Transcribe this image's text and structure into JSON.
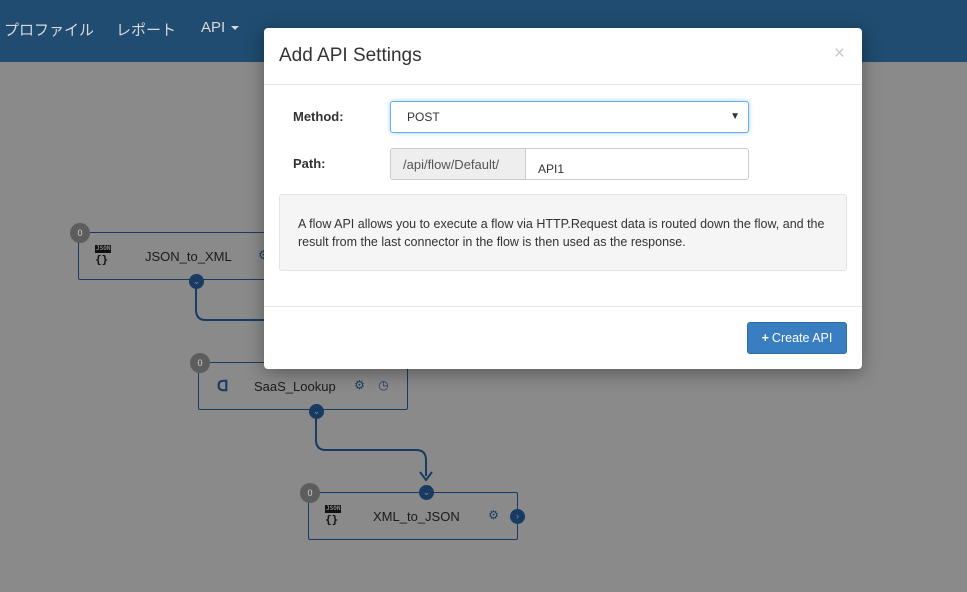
{
  "nav": {
    "items": [
      {
        "label": "プロファイル"
      },
      {
        "label": "レポート"
      },
      {
        "label": "API"
      }
    ]
  },
  "nodes": [
    {
      "label": "JSON_to_XML",
      "count": "0",
      "icon": "json-icon",
      "icon_tag": "JSON",
      "icon_glyph": "{}"
    },
    {
      "label": "SaaS_Lookup",
      "count": "0",
      "icon": "saas-connector-icon",
      "icon_glyph": "ᗡ"
    },
    {
      "label": "XML_to_JSON",
      "count": "0",
      "icon": "json-icon",
      "icon_tag": "JSON",
      "icon_glyph": "{}"
    }
  ],
  "modal": {
    "title": "Add API Settings",
    "close": "×",
    "method_label": "Method:",
    "method_value": "POST",
    "path_label": "Path:",
    "path_prefix": "/api/flow/Default/",
    "path_value": "API1",
    "info": "A flow API allows you to execute a flow via HTTP.Request data is routed down the flow, and the result from the last connector in the flow is then used as the response.",
    "create_button": "Create API",
    "create_icon": "+"
  },
  "colors": {
    "navbar": "#2a6496",
    "primary_button": "#3a7ec2",
    "node_border": "#173b62"
  }
}
